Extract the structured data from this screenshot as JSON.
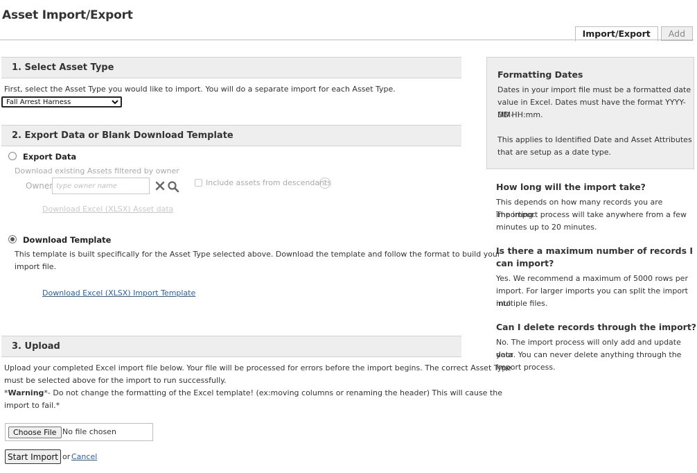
{
  "page": {
    "title": "Asset Import/Export"
  },
  "tabs": [
    {
      "label": "Import/Export",
      "active": true
    },
    {
      "label": "Add",
      "active": false
    }
  ],
  "section1": {
    "heading": "1. Select Asset Type",
    "description": "First, select the Asset Type you would like to import. You will do a separate import for each Asset Type.",
    "asset_type_selected": "Fall Arrest Harness"
  },
  "section2": {
    "heading": "2. Export Data or Blank Download Template",
    "export_data": {
      "label": "Export Data",
      "selected": false,
      "hint": "Download existing Assets filtered by owner",
      "owner_label": "Owner",
      "owner_placeholder": "type owner name",
      "include_descendants_label": "Include assets from descendants",
      "help_glyph": "?",
      "download_link": "Download Excel (XLSX) Asset data"
    },
    "download_template": {
      "label": "Download Template",
      "selected": true,
      "description_line1": "This template is built specifically for the Asset Type selected above. Download the template and follow the format to build your",
      "description_line2": "import file.",
      "download_link": "Download Excel (XLSX) Import Template"
    }
  },
  "section3": {
    "heading": "3. Upload",
    "description_line1": "Upload your completed Excel import file below. Your file will be processed for errors before the import begins. The correct Asset Type",
    "description_line2": "must be selected above for the import to run successfully.",
    "warning_prefix": "*",
    "warning_bold": "Warning",
    "warning_line1": "*- Do not change the formatting of the Excel template! (ex:moving columns or renaming the header) This will cause the",
    "warning_line2": "import to fail.*",
    "choose_file_label": "Choose File",
    "file_status": "No file chosen",
    "start_import_label": "Start Import",
    "or_text": "or",
    "cancel_label": "Cancel"
  },
  "sidebar": {
    "formatting": {
      "title": "Formatting Dates",
      "lines": [
        "Dates in your import file must be a formatted date",
        "value in Excel. Dates must have the format YYYY-MM-",
        "DD HH:mm."
      ],
      "lines2": [
        "This applies to Identified Date and Asset Attributes",
        "that are setup as a date type."
      ]
    },
    "faq": [
      {
        "q": [
          "How long will the import take?"
        ],
        "a": [
          "This depends on how many records you are importing.",
          "The import process will take anywhere from a few",
          "minutes up to 20 minutes."
        ]
      },
      {
        "q": [
          "Is there a maximum number of records I",
          "can import?"
        ],
        "a": [
          "Yes. We recommend a maximum of 5000 rows per",
          "import. For larger imports you can split the import into",
          "multiple files."
        ]
      },
      {
        "q": [
          "Can I delete records through the import?"
        ],
        "a": [
          "No. The import process will only add and update your",
          "data. You can never delete anything through the",
          "import process."
        ]
      }
    ]
  },
  "colors": {
    "header_bg": "#eeeeee",
    "link": "#2a5d9f",
    "disabled": "#c8c8c8"
  }
}
